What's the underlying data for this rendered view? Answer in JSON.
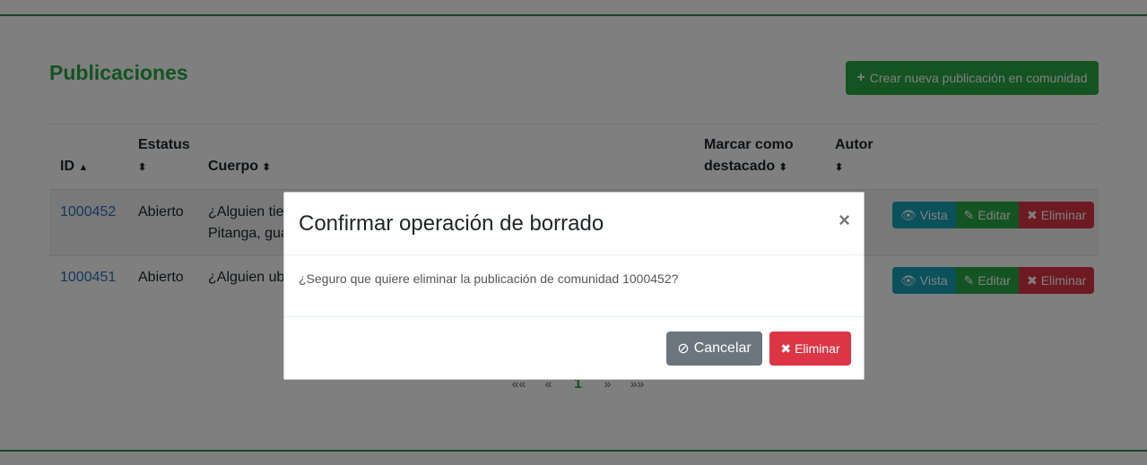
{
  "page": {
    "title": "Publicaciones",
    "create_button": "Crear nueva publicación en comunidad"
  },
  "table": {
    "headers": {
      "id": "ID",
      "estatus": "Estatus",
      "cuerpo": "Cuerpo",
      "marcar_line1": "Marcar como",
      "marcar_line2": "destacado",
      "autor": "Autor"
    },
    "rows": [
      {
        "id": "1000452",
        "estatus": "Abierto",
        "cuerpo_line1": "¿Alguien tie",
        "cuerpo_line2": "Pitanga, gua"
      },
      {
        "id": "1000451",
        "estatus": "Abierto",
        "cuerpo_line1": "¿Alguien ub"
      }
    ],
    "actions": {
      "view": "Vista",
      "edit": "Editar",
      "delete": "Eliminar"
    }
  },
  "pagination": {
    "first": "««",
    "prev": "«",
    "current": "1",
    "next": "»",
    "last": "»»"
  },
  "modal": {
    "title": "Confirmar operación de borrado",
    "close": "×",
    "message": "¿Seguro que quiere eliminar la publicación de comunidad 1000452?",
    "cancel": "Cancelar",
    "delete": "Eliminar"
  }
}
